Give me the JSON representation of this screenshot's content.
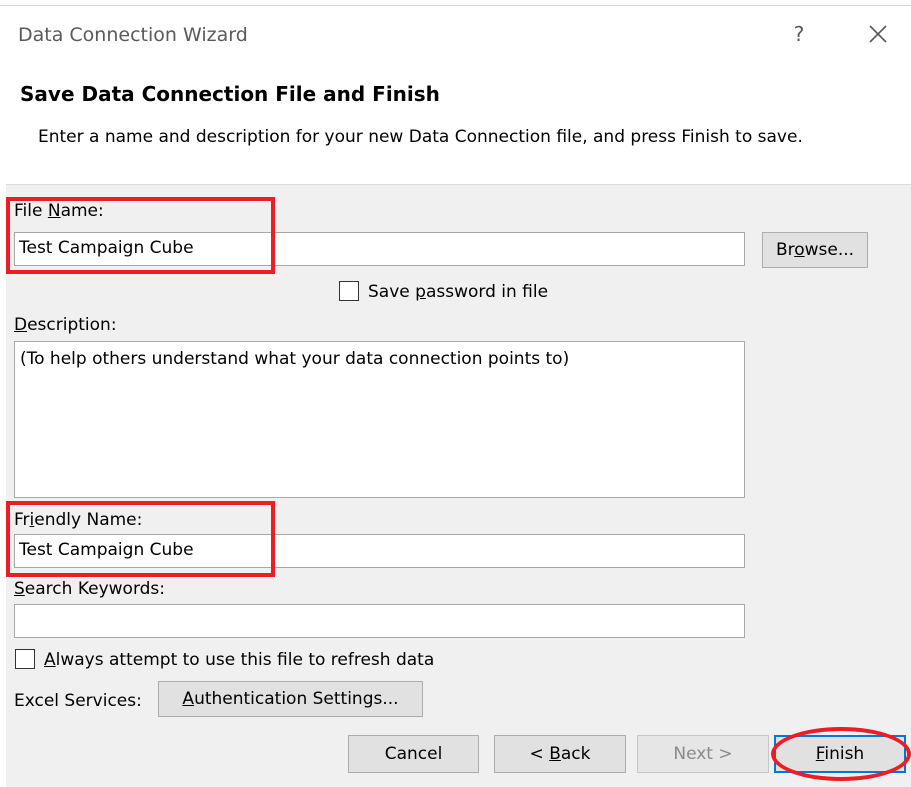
{
  "window": {
    "title": "Data Connection Wizard",
    "help_label": "?",
    "close_icon": "close-x-icon"
  },
  "header": {
    "title": "Save Data Connection File and Finish",
    "description": "Enter a name and description for your new Data Connection file, and press Finish to save."
  },
  "form": {
    "file_name": {
      "label_pre": "File ",
      "label_accel": "N",
      "label_post": "ame:",
      "value": "Test Campaign Cube"
    },
    "browse": {
      "label_pre": "Br",
      "label_accel": "o",
      "label_post": "wse..."
    },
    "save_password": {
      "label_pre": "Save ",
      "label_accel": "p",
      "label_post": "assword in file",
      "checked": false
    },
    "description": {
      "label_pre": "",
      "label_accel": "D",
      "label_post": "escription:",
      "value": "(To help others understand what your data connection points to)"
    },
    "friendly_name": {
      "label_pre": "Fr",
      "label_accel": "i",
      "label_post": "endly Name:",
      "value": "Test Campaign Cube"
    },
    "search_keywords": {
      "label_pre": "",
      "label_accel": "S",
      "label_post": "earch Keywords:",
      "value": ""
    },
    "always_refresh": {
      "label_pre": "",
      "label_accel": "A",
      "label_post": "lways attempt to use this file to refresh data",
      "checked": false
    },
    "excel_services_label": "Excel Services:",
    "auth_settings": {
      "label_pre": "",
      "label_accel": "A",
      "label_post": "uthentication Settings..."
    }
  },
  "footer": {
    "cancel": "Cancel",
    "back": {
      "label_pre": "< ",
      "label_accel": "B",
      "label_post": "ack"
    },
    "next": "Next >",
    "finish": {
      "label_pre": "",
      "label_accel": "F",
      "label_post": "inish"
    }
  },
  "colors": {
    "annotation_red": "#ee1c25",
    "focus_blue": "#0078d7",
    "panel_gray": "#f0f0f0"
  }
}
